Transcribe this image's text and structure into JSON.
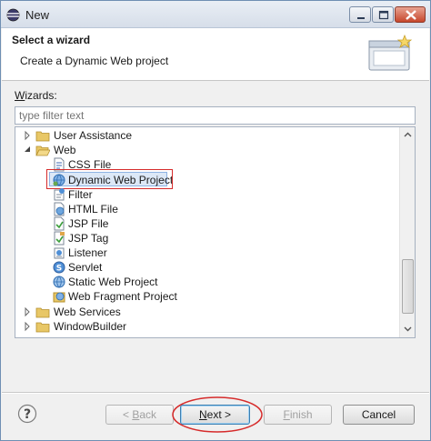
{
  "window": {
    "title": "New"
  },
  "header": {
    "title": "Select a wizard",
    "description": "Create a Dynamic Web project"
  },
  "wizards": {
    "label_prefix": "W",
    "label_rest": "izards:",
    "filter_placeholder": "type filter text"
  },
  "tree": {
    "items": [
      {
        "label": "User Assistance",
        "icon": "folder-icon",
        "expanded": false
      },
      {
        "label": "Web",
        "icon": "folder-icon",
        "expanded": true
      },
      {
        "label": "CSS File",
        "icon": "css-file-icon"
      },
      {
        "label": "Dynamic Web Project",
        "icon": "web-project-icon",
        "selected": true
      },
      {
        "label": "Filter",
        "icon": "filter-icon"
      },
      {
        "label": "HTML File",
        "icon": "html-file-icon"
      },
      {
        "label": "JSP File",
        "icon": "jsp-file-icon"
      },
      {
        "label": "JSP Tag",
        "icon": "jsp-tag-icon"
      },
      {
        "label": "Listener",
        "icon": "listener-icon"
      },
      {
        "label": "Servlet",
        "icon": "servlet-icon"
      },
      {
        "label": "Static Web Project",
        "icon": "static-web-project-icon"
      },
      {
        "label": "Web Fragment Project",
        "icon": "web-fragment-project-icon"
      },
      {
        "label": "Web Services",
        "icon": "folder-icon",
        "expanded": false
      },
      {
        "label": "WindowBuilder",
        "icon": "folder-icon",
        "expanded": false
      }
    ]
  },
  "buttons": {
    "back_prefix": "< ",
    "back_u": "B",
    "back_rest": "ack",
    "next_u": "N",
    "next_rest": "ext >",
    "finish_u": "F",
    "finish_rest": "inish",
    "cancel": "Cancel"
  },
  "colors": {
    "highlight_outline": "#d62b2b",
    "selection": "#dce8f7",
    "window_border": "#6f8fb3"
  }
}
